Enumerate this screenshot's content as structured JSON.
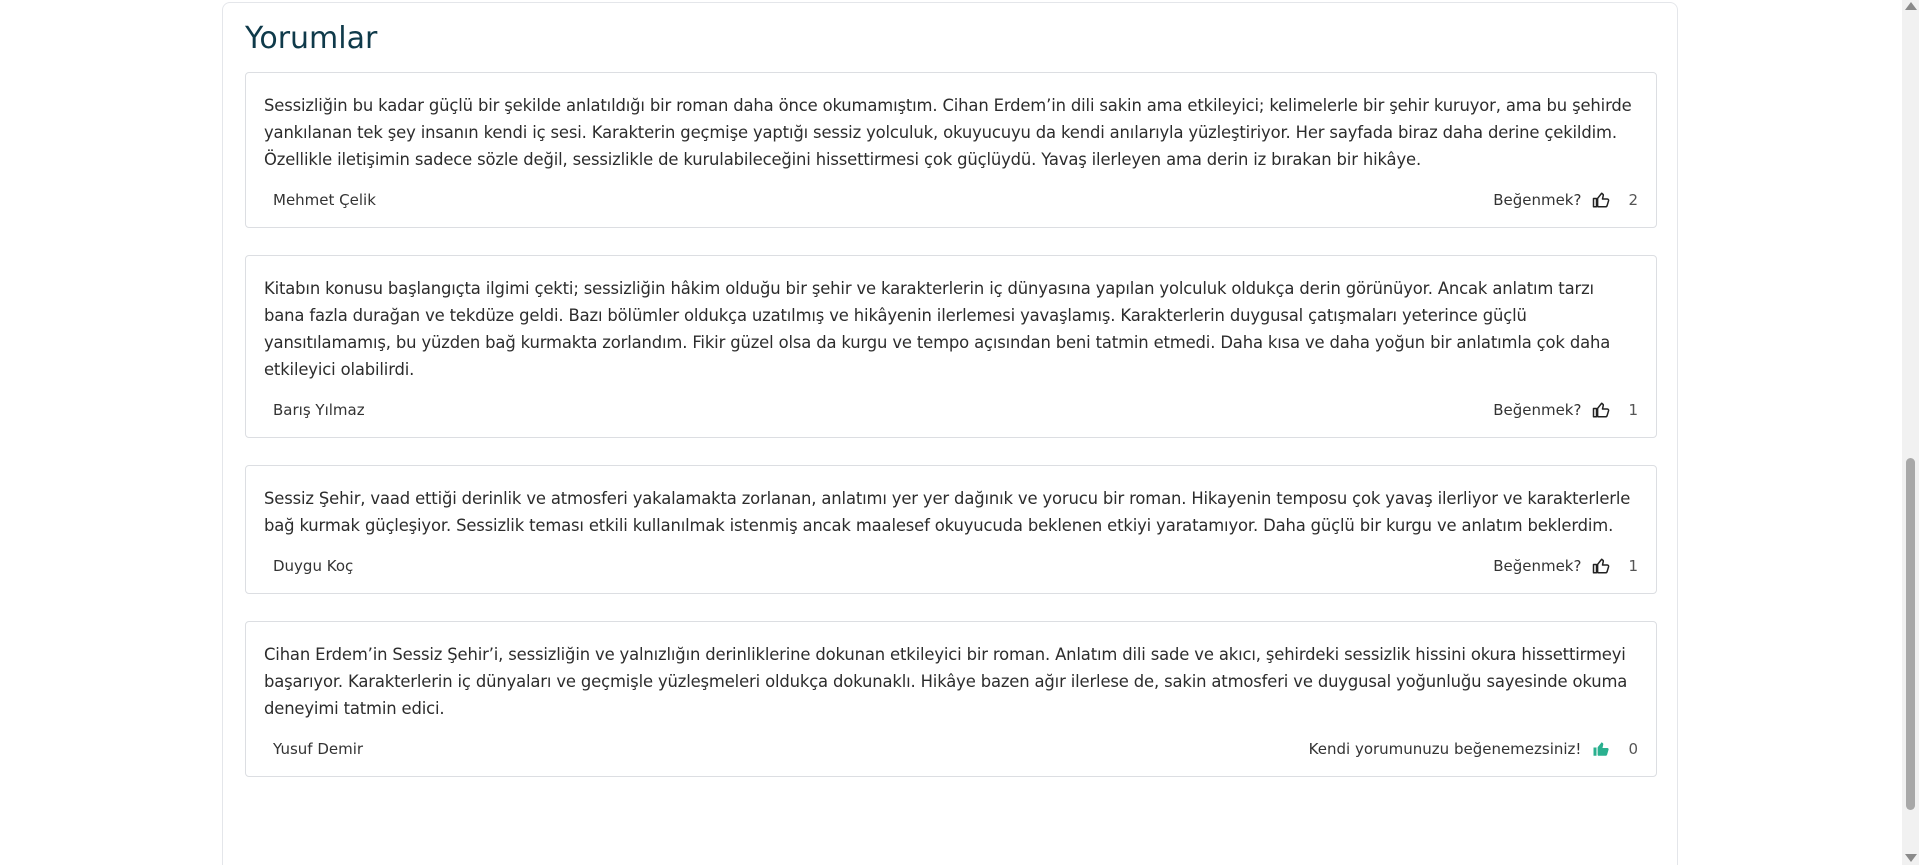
{
  "section": {
    "title": "Yorumlar"
  },
  "colors": {
    "title": "#0f3a4a",
    "own_like_icon": "#2ab08f",
    "like_icon": "#222222"
  },
  "comments": [
    {
      "text": "Sessizliğin bu kadar güçlü bir şekilde anlatıldığı bir roman daha önce okumamıştım. Cihan Erdem’in dili sakin ama etkileyici; kelimelerle bir şehir kuruyor, ama bu şehirde yankılanan tek şey insanın kendi iç sesi. Karakterin geçmişe yaptığı sessiz yolculuk, okuyucuyu da kendi anılarıyla yüzleştiriyor. Her sayfada biraz daha derine çekildim. Özellikle iletişimin sadece sözle değil, sessizlikle de kurulabileceğini hissettirmesi çok güçlüydü. Yavaş ilerleyen ama derin iz bırakan bir hikâye.",
      "author": "Mehmet Çelik",
      "like_label": "Beğenmek?",
      "like_icon": "thumbs-up-outline-icon",
      "likes": "2"
    },
    {
      "text": "Kitabın konusu başlangıçta ilgimi çekti; sessizliğin hâkim olduğu bir şehir ve karakterlerin iç dünyasına yapılan yolculuk oldukça derin görünüyor. Ancak anlatım tarzı bana fazla durağan ve tekdüze geldi. Bazı bölümler oldukça uzatılmış ve hikâyenin ilerlemesi yavaşlamış. Karakterlerin duygusal çatışmaları yeterince güçlü yansıtılamamış, bu yüzden bağ kurmakta zorlandım. Fikir güzel olsa da kurgu ve tempo açısından beni tatmin etmedi. Daha kısa ve daha yoğun bir anlatımla çok daha etkileyici olabilirdi.",
      "author": "Barış Yılmaz",
      "like_label": "Beğenmek?",
      "like_icon": "thumbs-up-outline-icon",
      "likes": "1"
    },
    {
      "text": "Sessiz Şehir, vaad ettiği derinlik ve atmosferi yakalamakta zorlanan, anlatımı yer yer dağınık ve yorucu bir roman. Hikayenin temposu çok yavaş ilerliyor ve karakterlerle bağ kurmak güçleşiyor. Sessizlik teması etkili kullanılmak istenmiş ancak maalesef okuyucuda beklenen etkiyi yaratamıyor. Daha güçlü bir kurgu ve anlatım beklerdim.",
      "author": "Duygu Koç",
      "like_label": "Beğenmek?",
      "like_icon": "thumbs-up-outline-icon",
      "likes": "1"
    },
    {
      "text": "Cihan Erdem’in Sessiz Şehir’i, sessizliğin ve yalnızlığın derinliklerine dokunan etkileyici bir roman. Anlatım dili sade ve akıcı, şehirdeki sessizlik hissini okura hissettirmeyi başarıyor. Karakterlerin iç dünyaları ve geçmişle yüzleşmeleri oldukça dokunaklı. Hikâye bazen ağır ilerlese de, sakin atmosferi ve duygusal yoğunluğu sayesinde okuma deneyimi tatmin edici.",
      "author": "Yusuf Demir",
      "like_label": "Kendi yorumunuzu beğenemezsiniz!",
      "like_icon": "thumbs-up-filled-icon",
      "likes": "0"
    }
  ]
}
